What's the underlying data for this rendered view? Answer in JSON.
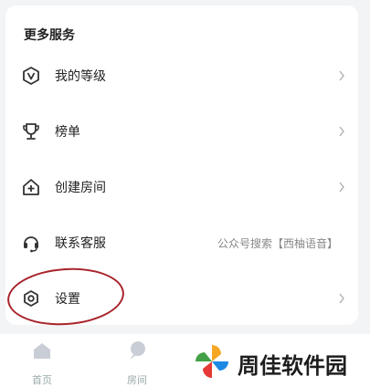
{
  "section": {
    "title": "更多服务"
  },
  "items": [
    {
      "label": "我的等级",
      "icon": "level-v-icon",
      "extra": ""
    },
    {
      "label": "榜单",
      "icon": "trophy-icon",
      "extra": ""
    },
    {
      "label": "创建房间",
      "icon": "create-room-icon",
      "extra": ""
    },
    {
      "label": "联系客服",
      "icon": "headset-icon",
      "extra": "公众号搜索【西柚语音】"
    },
    {
      "label": "设置",
      "icon": "settings-icon",
      "extra": ""
    }
  ],
  "tabs": [
    {
      "label": "首页",
      "icon": "home-icon"
    },
    {
      "label": "房间",
      "icon": "room-icon"
    }
  ],
  "watermark": {
    "text": "周佳软件园"
  },
  "colors": {
    "circle_annotation": "#a8242b",
    "icon": "#333333",
    "chevron": "#b0b0b0"
  }
}
